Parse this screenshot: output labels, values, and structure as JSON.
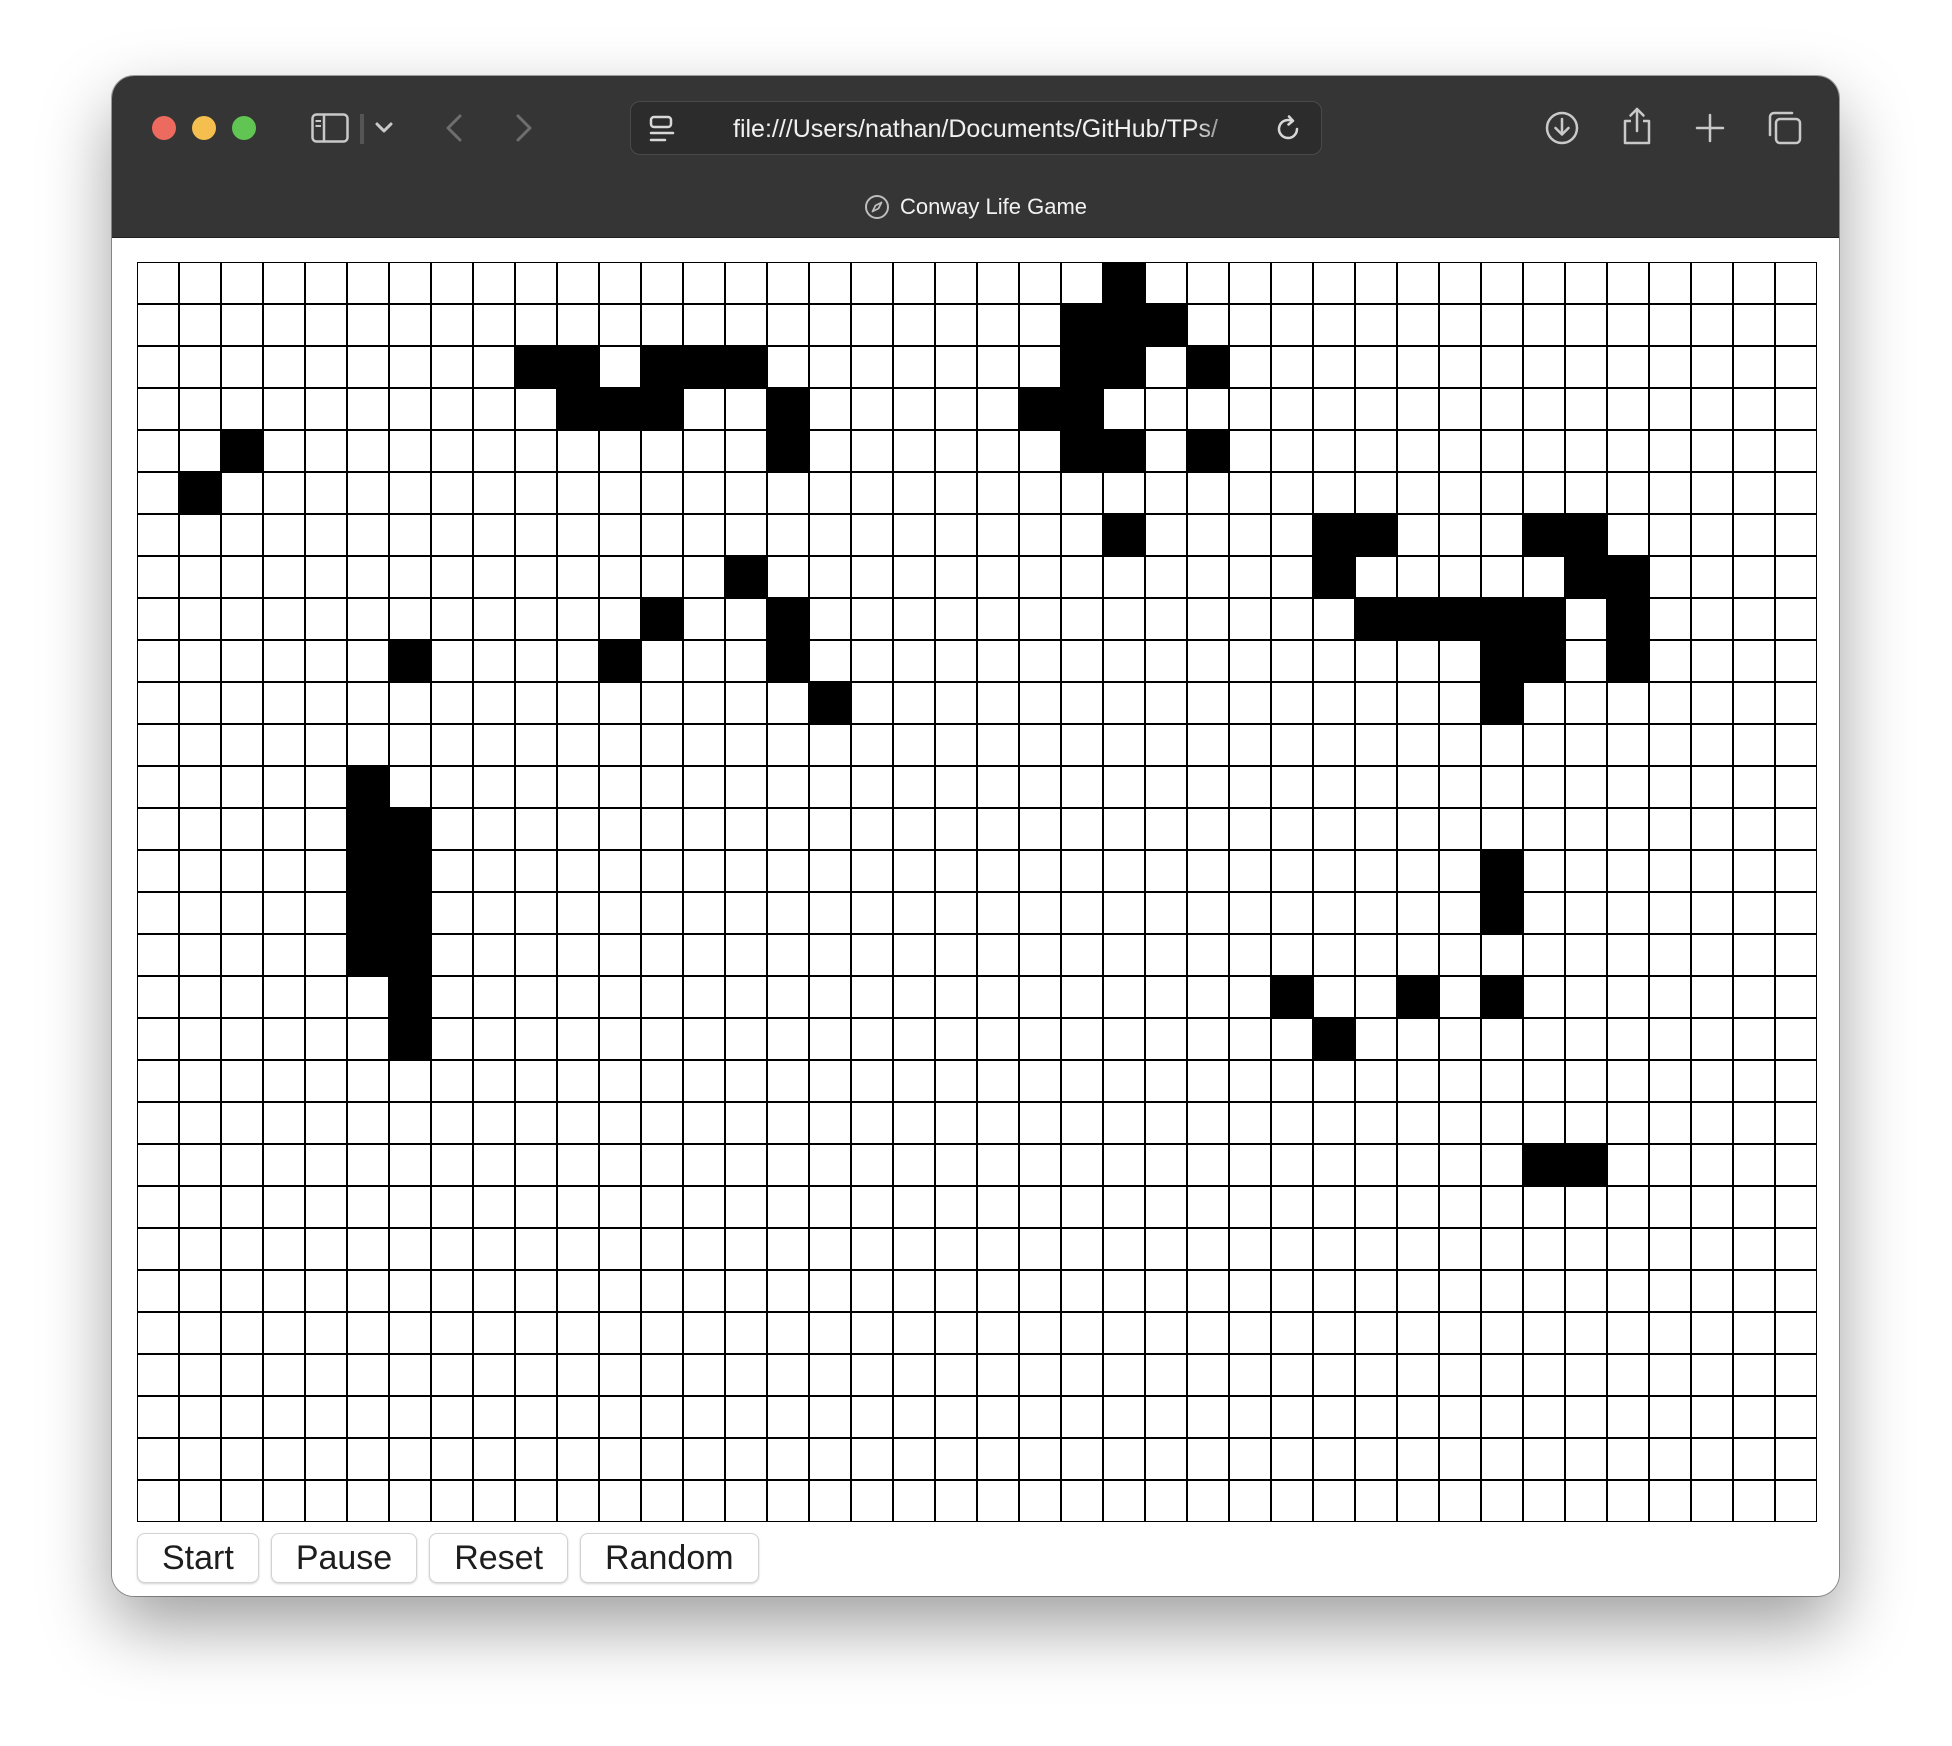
{
  "browser": {
    "url": "file:///Users/nathan/Documents/GitHub/TPs/",
    "tab_title": "Conway Life Game",
    "icons": {
      "sidebar": "sidebar-icon",
      "sidebar_menu": "chevron-down-icon",
      "back": "chevron-left-icon",
      "forward": "chevron-right-icon",
      "page_menu": "page-menu-icon",
      "reload": "reload-icon",
      "download": "download-icon",
      "share": "share-icon",
      "new_tab": "plus-icon",
      "tab_overview": "tabs-overview-icon",
      "favicon": "compass-icon"
    }
  },
  "game": {
    "cols": 40,
    "rows": 30,
    "live_color": "#000000",
    "dead_color": "#ffffff",
    "grid_line_color": "#000000",
    "cells": [
      "0000000000000000000000010000000000000000",
      "0000000000000000000000111000000000000000",
      "0000000001101110000000110100000000000000",
      "0000000000111001000001100000000000000000",
      "0010000000000001000000110100000000000000",
      "0100000000000000000000000000000000000000",
      "0000000000000000000000010000110001100000",
      "0000000000000010000000000000100000110000",
      "0000000000001001000000000000011111010000",
      "0000001000010001000000000000000011010000",
      "0000000000000000100000000000000010000000",
      "0000000000000000000000000000000000000000",
      "0000010000000000000000000000000000000000",
      "0000011000000000000000000000000000000000",
      "0000011000000000000000000000000010000000",
      "0000011000000000000000000000000010000000",
      "0000011000000000000000000000000000000000",
      "0000001000000000000000000001001010000000",
      "0000001000000000000000000000100000000000",
      "0000000000000000000000000000000000000000",
      "0000000000000000000000000000000000000000",
      "0000000000000000000000000000000001100000",
      "0000000000000000000000000000000000000000",
      "0000000000000000000000000000000000000000",
      "0000000000000000000000000000000000000000",
      "0000000000000000000000000000000000000000",
      "0000000000000000000000000000000000000000",
      "0000000000000000000000000000000000000000",
      "0000000000000000000000000000000000000000",
      "0000000000000000000000000000000000000000"
    ]
  },
  "controls": {
    "start": "Start",
    "pause": "Pause",
    "reset": "Reset",
    "random": "Random"
  }
}
